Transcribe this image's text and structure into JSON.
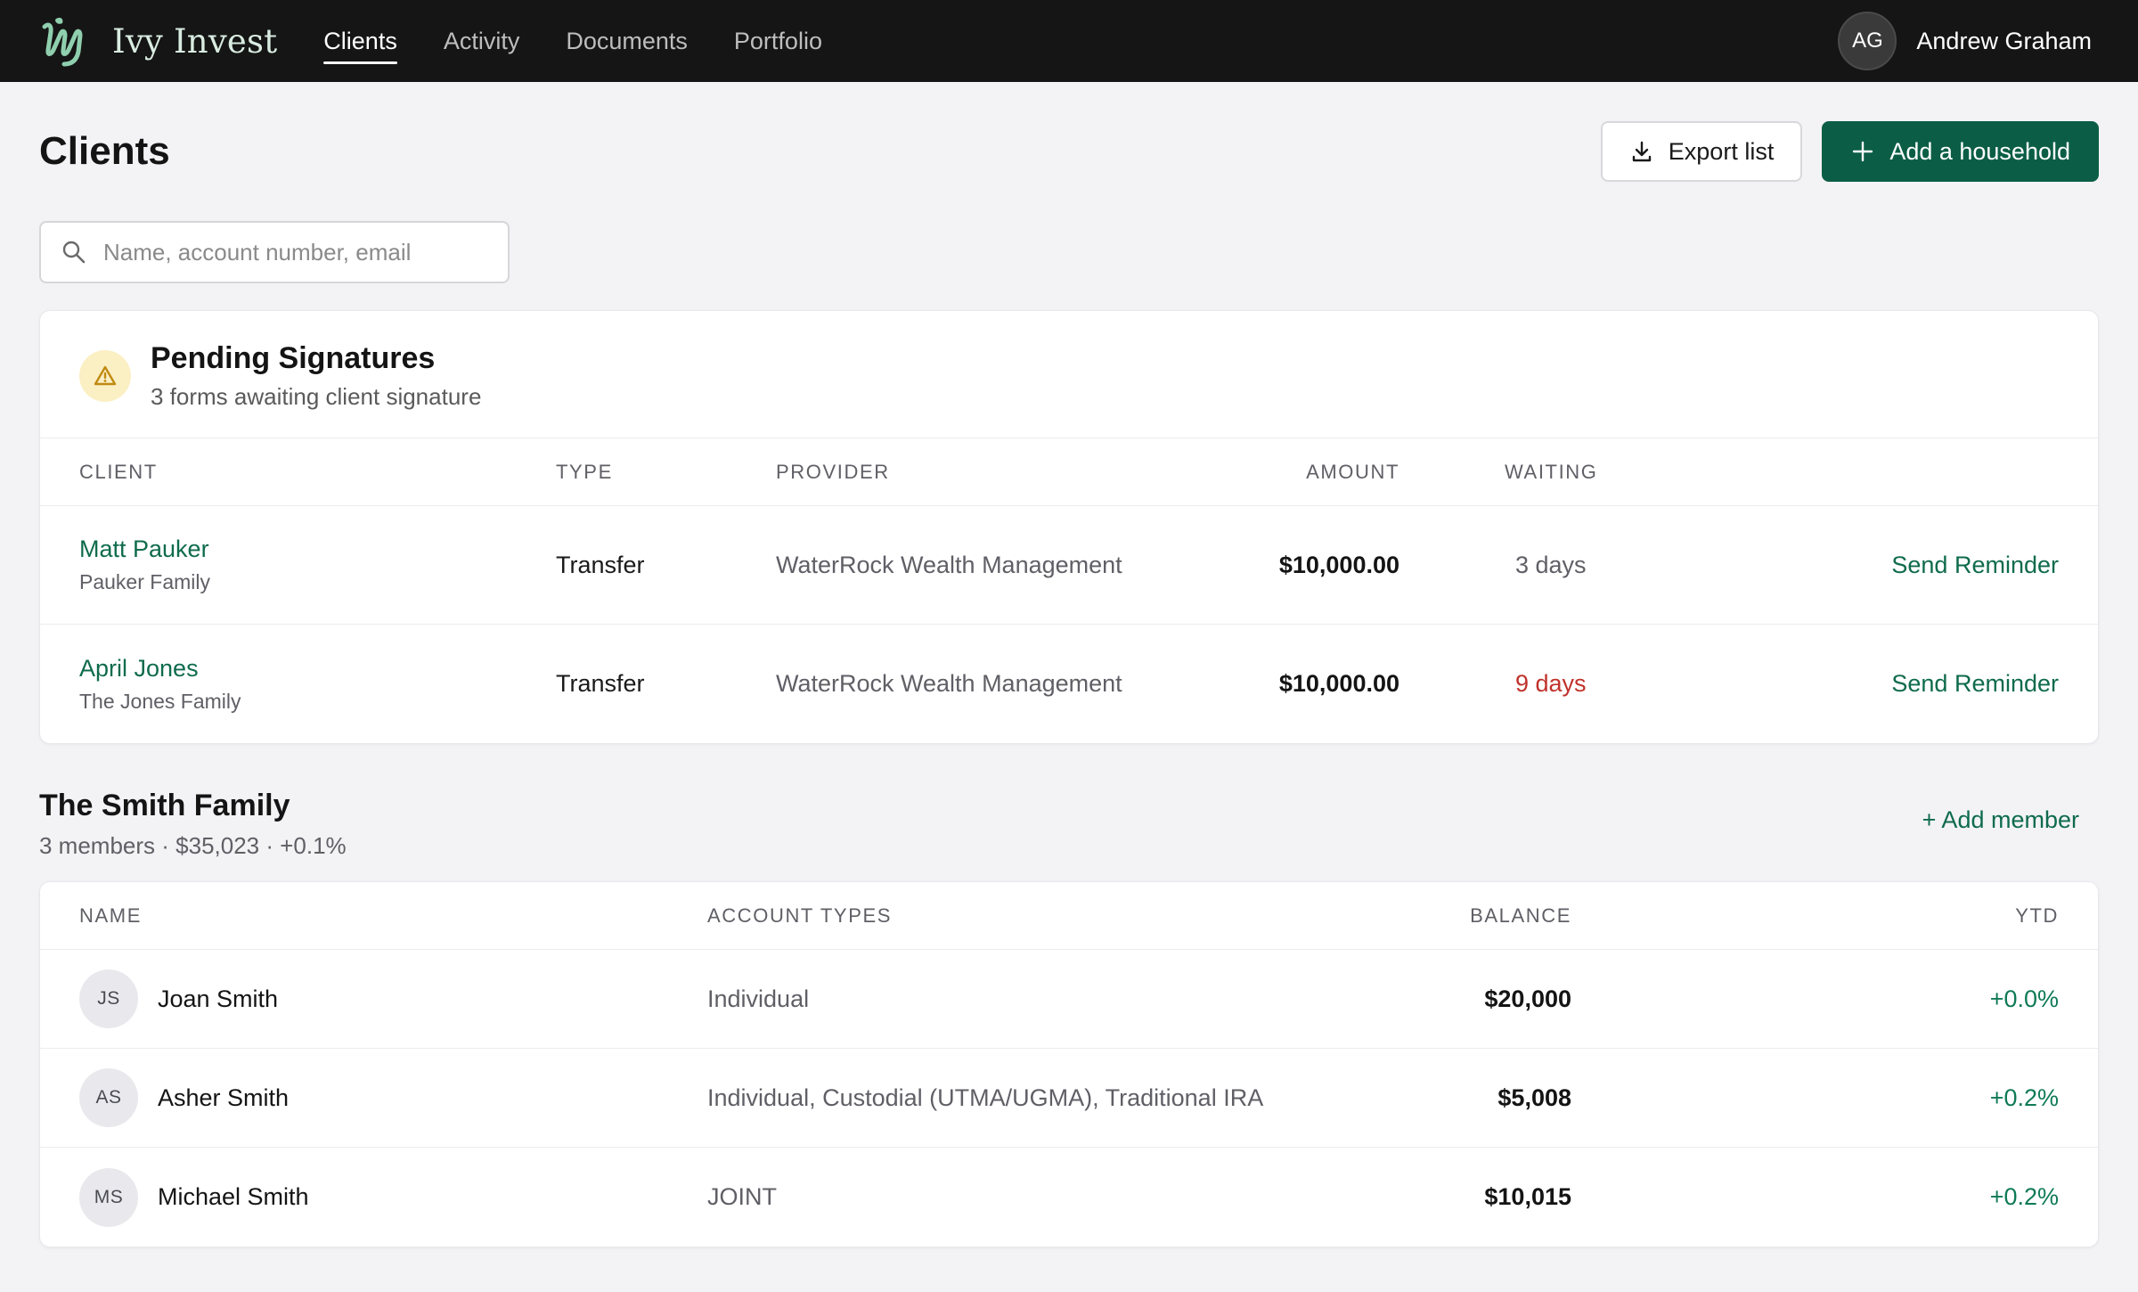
{
  "nav": {
    "brand": "Ivy Invest",
    "items": [
      {
        "label": "Clients",
        "active": true
      },
      {
        "label": "Activity",
        "active": false
      },
      {
        "label": "Documents",
        "active": false
      },
      {
        "label": "Portfolio",
        "active": false
      }
    ],
    "user": {
      "initials": "AG",
      "name": "Andrew Graham"
    }
  },
  "header": {
    "title": "Clients",
    "export_label": "Export list",
    "add_household_label": "Add a household"
  },
  "search": {
    "placeholder": "Name, account number, email",
    "value": ""
  },
  "pending": {
    "title": "Pending Signatures",
    "subtitle": "3 forms awaiting client signature",
    "columns": {
      "client": "Client",
      "type": "Type",
      "provider": "Provider",
      "amount": "Amount",
      "waiting": "Waiting"
    },
    "rows": [
      {
        "name": "Matt Pauker",
        "family": "Pauker Family",
        "type": "Transfer",
        "provider": "WaterRock Wealth Management",
        "amount": "$10,000.00",
        "waiting": "3 days",
        "overdue": false,
        "action": "Send Reminder"
      },
      {
        "name": "April Jones",
        "family": "The Jones Family",
        "type": "Transfer",
        "provider": "WaterRock Wealth Management",
        "amount": "$10,000.00",
        "waiting": "9 days",
        "overdue": true,
        "action": "Send Reminder"
      }
    ]
  },
  "family": {
    "title": "The Smith Family",
    "meta": "3 members  · $35,023 · +0.1%",
    "add_member_label": "+ Add member",
    "columns": {
      "name": "Name",
      "account_types": "Account Types",
      "balance": "Balance",
      "ytd": "YTD"
    },
    "members": [
      {
        "initials": "JS",
        "name": "Joan Smith",
        "account_types": "Individual",
        "balance": "$20,000",
        "ytd": "+0.0%"
      },
      {
        "initials": "AS",
        "name": "Asher Smith",
        "account_types": "Individual, Custodial (UTMA/UGMA), Traditional IRA",
        "balance": "$5,008",
        "ytd": "+0.2%"
      },
      {
        "initials": "MS",
        "name": "Michael Smith",
        "account_types": "JOINT",
        "balance": "$10,015",
        "ytd": "+0.2%"
      }
    ]
  },
  "colors": {
    "brand_green": "#0b5e45",
    "link_green": "#0f6b4d",
    "overdue_red": "#c0322b",
    "topbar": "#151515"
  },
  "icons": {
    "logo": "ivy-leaf-logo",
    "export": "download-icon",
    "add": "plus-icon",
    "search": "search-icon",
    "warning": "warning-triangle-icon"
  }
}
